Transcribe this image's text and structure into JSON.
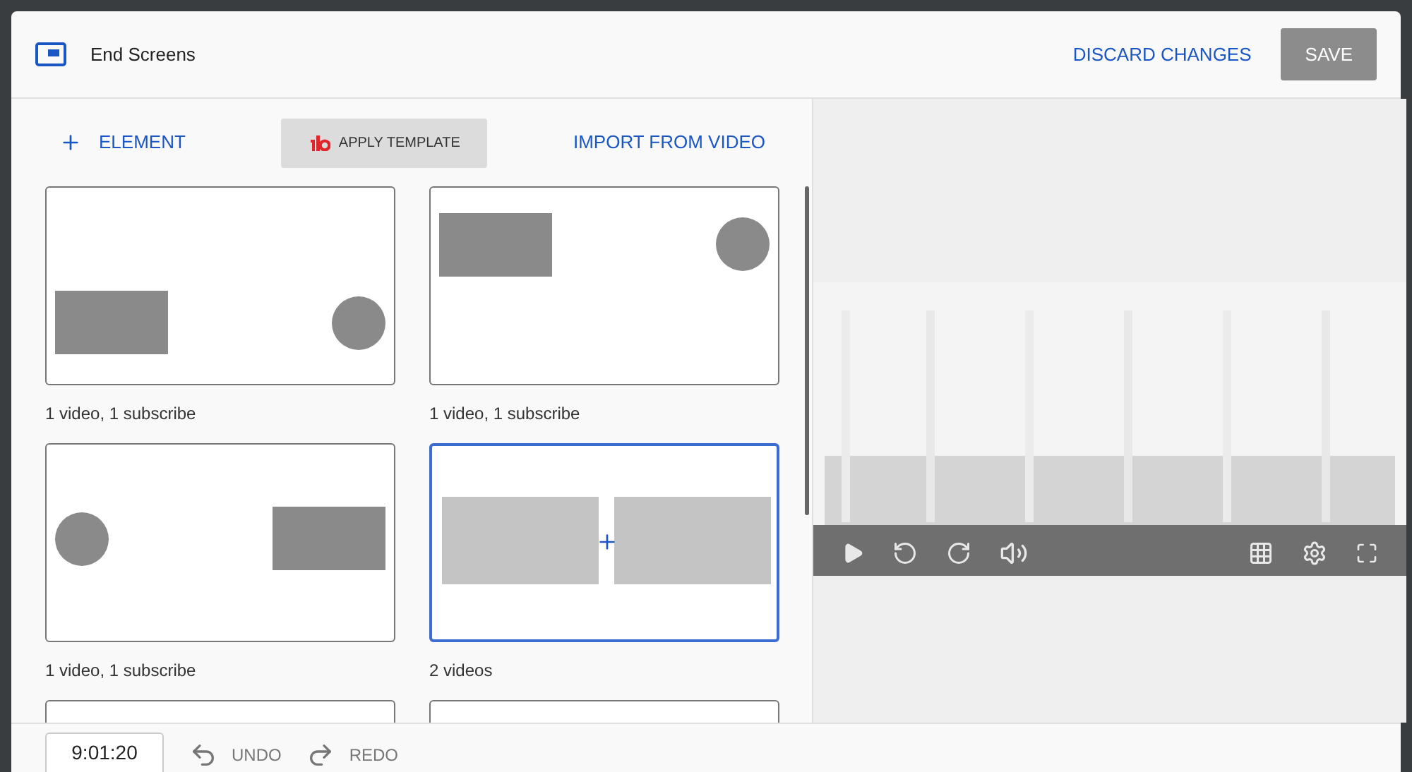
{
  "header": {
    "title": "End Screens",
    "buttons": [
      {
        "label": "DISCARD CHANGES",
        "kind": "text"
      },
      {
        "label": "SAVE",
        "kind": "filled"
      }
    ]
  },
  "toolbar": {
    "element_button": "ELEMENT",
    "template_button": "APPLY TEMPLATE",
    "import_button": "IMPORT FROM VIDEO"
  },
  "templates": [
    {
      "kind": "video-low-subscribe-right",
      "label": "1 video, 1 subscribe",
      "selected": false
    },
    {
      "kind": "video-high-subscribe-right",
      "label": "1 video, 1 subscribe",
      "selected": false
    },
    {
      "kind": "subscribe-left-video-right",
      "label": "1 video, 1 subscribe",
      "selected": false
    },
    {
      "kind": "two-videos",
      "label": "2 videos",
      "selected": true
    },
    {
      "kind": "cut",
      "selected": false
    },
    {
      "kind": "cut",
      "selected": false
    }
  ],
  "footer": {
    "time": "9:01:20",
    "undo": "UNDO",
    "redo": "REDO"
  }
}
